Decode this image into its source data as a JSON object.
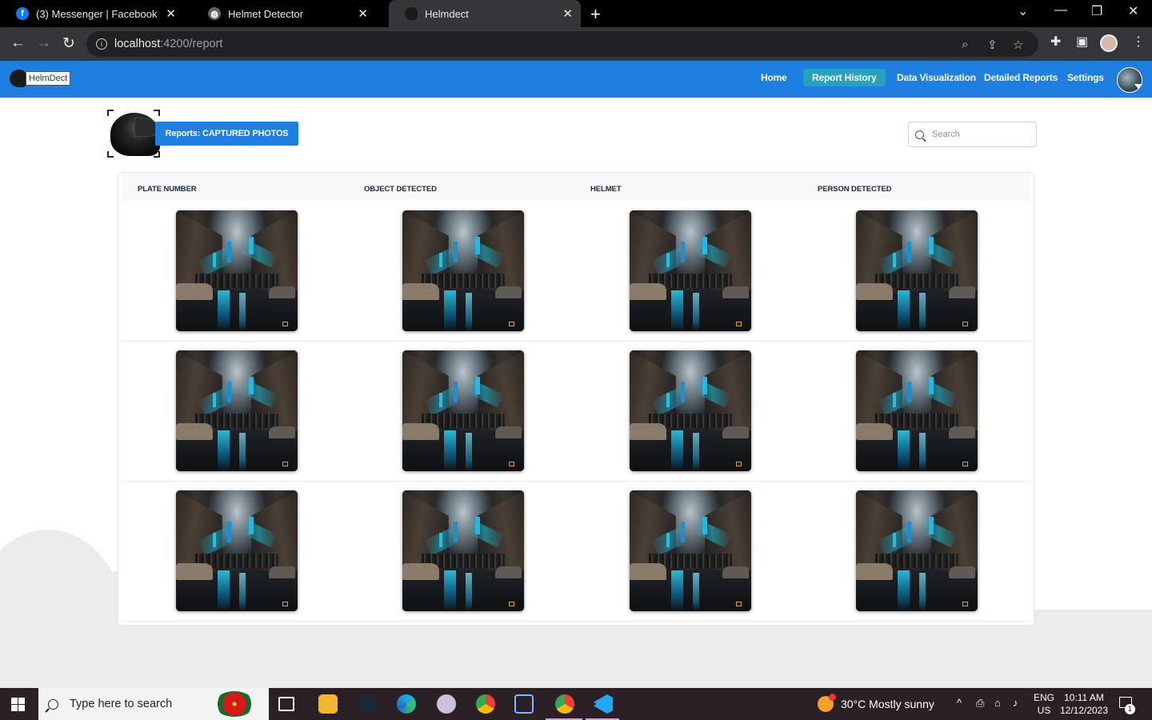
{
  "browser": {
    "tabs": [
      {
        "title": "(3) Messenger | Facebook",
        "icon": "facebook-icon"
      },
      {
        "title": "Helmet Detector",
        "icon": "globe-icon"
      },
      {
        "title": "Helmdect",
        "icon": "helmet-icon"
      }
    ],
    "url_host": "localhost",
    "url_path": ":4200/report"
  },
  "app": {
    "logo_text": "HelmDect",
    "nav": [
      {
        "label": "Home"
      },
      {
        "label": "Report History"
      },
      {
        "label": "Data Visualization"
      },
      {
        "label": "Detailed Reports"
      },
      {
        "label": "Settings"
      }
    ],
    "active_nav": "Report History"
  },
  "report": {
    "title": "Reports: CAPTURED PHOTOS",
    "search_placeholder": "Search",
    "columns": [
      "PLATE NUMBER",
      "OBJECT DETECTED",
      "HELMET",
      "PERSON DETECTED"
    ],
    "rows": [
      {
        "plate_number": "captured-photo",
        "object_detected": "captured-photo",
        "helmet": "captured-photo",
        "person_detected": "captured-photo"
      },
      {
        "plate_number": "captured-photo",
        "object_detected": "captured-photo",
        "helmet": "captured-photo",
        "person_detected": "captured-photo"
      },
      {
        "plate_number": "captured-photo",
        "object_detected": "captured-photo",
        "helmet": "captured-photo",
        "person_detected": "captured-photo"
      }
    ]
  },
  "taskbar": {
    "search_text": "Type here to search",
    "weather": "30°C  Mostly sunny",
    "lang_line1": "ENG",
    "lang_line2": "US",
    "time": "10:11 AM",
    "date": "12/12/2023",
    "notification_count": "1"
  },
  "colors": {
    "header_blue": "#1e7fe0",
    "active_nav_teal": "#26a1c0",
    "taskbar": "#2a2026"
  }
}
